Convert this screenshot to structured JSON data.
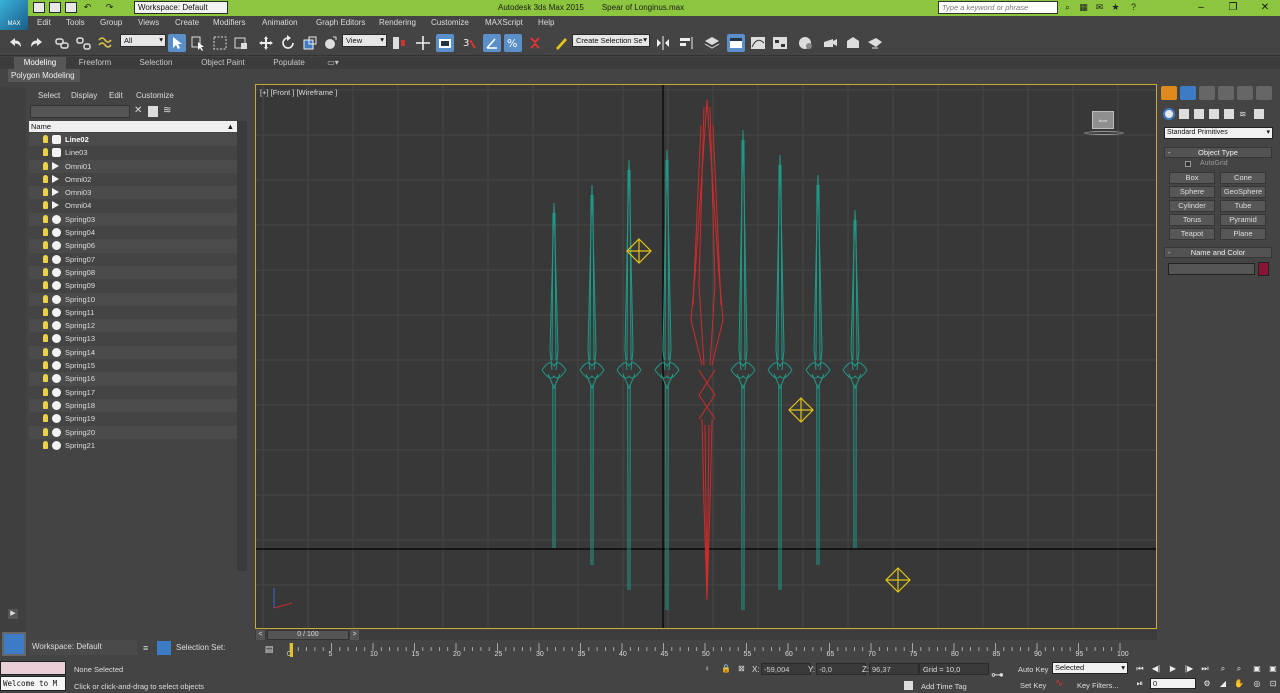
{
  "app": {
    "title": "Autodesk 3ds Max  2015",
    "file": "Spear of Longinus.max",
    "logo": "MAX",
    "workspace_top": "Workspace: Default",
    "search_placeholder": "Type a keyword or phrase"
  },
  "menu": [
    "Edit",
    "Tools",
    "Group",
    "Views",
    "Create",
    "Modifiers",
    "Animation",
    "Graph Editors",
    "Rendering",
    "Customize",
    "MAXScript",
    "Help"
  ],
  "toolbar": {
    "selection_filter": "All",
    "ref_coord": "View",
    "named_selection": "Create Selection Se"
  },
  "ribbon": {
    "tabs": [
      "Modeling",
      "Freeform",
      "Selection",
      "Object Paint",
      "Populate"
    ],
    "active_tab": "Modeling",
    "sub_panel": "Polygon Modeling"
  },
  "explorer": {
    "menu": [
      "Select",
      "Display",
      "Edit",
      "Customize"
    ],
    "column_name": "Name",
    "sort_icon": "▲",
    "items": [
      {
        "name": "Line02",
        "kind": "shape",
        "bold": true
      },
      {
        "name": "Line03",
        "kind": "shape",
        "bold": false
      },
      {
        "name": "Omni01",
        "kind": "light",
        "bold": false
      },
      {
        "name": "Omni02",
        "kind": "light",
        "bold": false
      },
      {
        "name": "Omni03",
        "kind": "light",
        "bold": false
      },
      {
        "name": "Omni04",
        "kind": "light",
        "bold": false
      },
      {
        "name": "Spring03",
        "kind": "geo",
        "bold": false
      },
      {
        "name": "Spring04",
        "kind": "geo",
        "bold": false
      },
      {
        "name": "Spring06",
        "kind": "geo",
        "bold": false
      },
      {
        "name": "Spring07",
        "kind": "geo",
        "bold": false
      },
      {
        "name": "Spring08",
        "kind": "geo",
        "bold": false
      },
      {
        "name": "Spring09",
        "kind": "geo",
        "bold": false
      },
      {
        "name": "Spring10",
        "kind": "geo",
        "bold": false
      },
      {
        "name": "Spring11",
        "kind": "geo",
        "bold": false
      },
      {
        "name": "Spring12",
        "kind": "geo",
        "bold": false
      },
      {
        "name": "Spring13",
        "kind": "geo",
        "bold": false
      },
      {
        "name": "Spring14",
        "kind": "geo",
        "bold": false
      },
      {
        "name": "Spring15",
        "kind": "geo",
        "bold": false
      },
      {
        "name": "Spring16",
        "kind": "geo",
        "bold": false
      },
      {
        "name": "Spring17",
        "kind": "geo",
        "bold": false
      },
      {
        "name": "Spring18",
        "kind": "geo",
        "bold": false
      },
      {
        "name": "Spring19",
        "kind": "geo",
        "bold": false
      },
      {
        "name": "Spring20",
        "kind": "geo",
        "bold": false
      },
      {
        "name": "Spring21",
        "kind": "geo",
        "bold": false
      }
    ]
  },
  "viewport": {
    "label": "[+] [Front ] [Wireframe ]",
    "viewcube_label": "front",
    "colors": {
      "spears": "#1f9a88",
      "selected": "#d42a2a",
      "light": "#e2c418",
      "grid": "#474747",
      "axis": "#000000",
      "border": "#c8a83a"
    }
  },
  "command_panel": {
    "category": "Standard Primitives",
    "object_type_title": "Object Type",
    "autogrid": "AutoGrid",
    "buttons": [
      "Box",
      "Cone",
      "Sphere",
      "GeoSphere",
      "Cylinder",
      "Tube",
      "Torus",
      "Pyramid",
      "Teapot",
      "Plane"
    ],
    "name_color_title": "Name and Color",
    "object_color": "#8a1436"
  },
  "timeline": {
    "frame": "0 / 100",
    "ticks": [
      "0",
      "5",
      "10",
      "15",
      "20",
      "25",
      "30",
      "35",
      "40",
      "45",
      "50",
      "55",
      "60",
      "65",
      "70",
      "75",
      "80",
      "85",
      "90",
      "95",
      "100"
    ]
  },
  "bottom": {
    "workspace": "Workspace: Default",
    "selection_set": "Selection Set:"
  },
  "status": {
    "listener": "Welcome to M",
    "selection": "None Selected",
    "prompt": "Click or click-and-drag to select objects",
    "x_label": "X:",
    "x": "-59,004",
    "y_label": "Y:",
    "y": "-0,0",
    "z_label": "Z:",
    "z": "96,37",
    "grid": "Grid = 10,0",
    "add_time_tag": "Add Time Tag",
    "auto_key": "Auto Key",
    "set_key": "Set Key",
    "key_mode": "Selected",
    "key_filters": "Key Filters...",
    "frame": "0"
  }
}
